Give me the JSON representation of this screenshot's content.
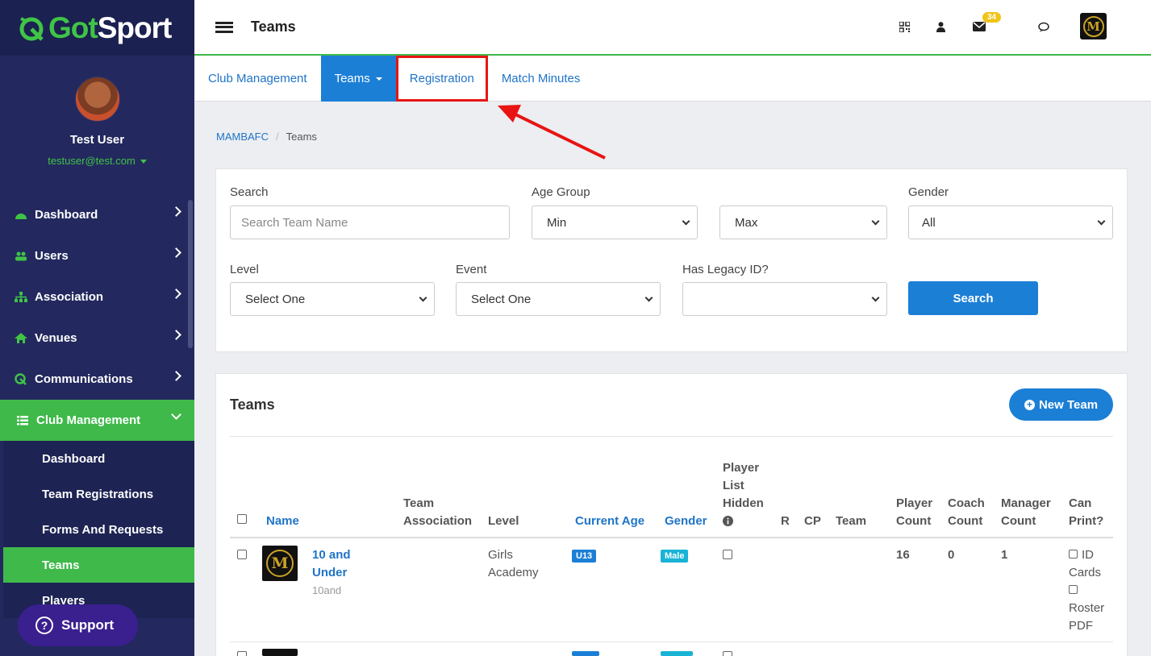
{
  "brand": {
    "logo_prefix": "Got",
    "logo_suffix": "Sport"
  },
  "user": {
    "name": "Test User",
    "email": "testuser@test.com"
  },
  "sidebar": {
    "items": [
      {
        "label": "Dashboard"
      },
      {
        "label": "Users"
      },
      {
        "label": "Association"
      },
      {
        "label": "Venues"
      },
      {
        "label": "Communications"
      },
      {
        "label": "Club Management"
      }
    ],
    "sub_items": [
      {
        "label": "Dashboard"
      },
      {
        "label": "Team Registrations"
      },
      {
        "label": "Forms And Requests"
      },
      {
        "label": "Teams"
      },
      {
        "label": "Players"
      }
    ],
    "support_label": "Support"
  },
  "topbar": {
    "title": "Teams",
    "mail_badge": "34",
    "club_logo_letter": "M"
  },
  "tabs": [
    {
      "label": "Club Management"
    },
    {
      "label": "Teams"
    },
    {
      "label": "Registration"
    },
    {
      "label": "Match Minutes"
    }
  ],
  "breadcrumb": {
    "root": "MAMBAFC",
    "current": "Teams"
  },
  "filters": {
    "search_label": "Search",
    "search_placeholder": "Search Team Name",
    "age_group_label": "Age Group",
    "age_min": "Min",
    "age_max": "Max",
    "gender_label": "Gender",
    "gender_value": "All",
    "level_label": "Level",
    "level_value": "Select One",
    "event_label": "Event",
    "event_value": "Select One",
    "legacy_label": "Has Legacy ID?",
    "legacy_value": "",
    "search_button": "Search"
  },
  "teams": {
    "title": "Teams",
    "new_team_button": "New Team",
    "columns": {
      "name": "Name",
      "team_association_1": "Team",
      "team_association_2": "Association",
      "level": "Level",
      "current_age": "Current Age",
      "gender": "Gender",
      "hidden_1": "Player",
      "hidden_2": "List",
      "hidden_3": "Hidden",
      "r": "R",
      "cp": "CP",
      "team": "Team",
      "player_count_1": "Player",
      "player_count_2": "Count",
      "coach_count_1": "Coach",
      "coach_count_2": "Count",
      "manager_count_1": "Manager",
      "manager_count_2": "Count",
      "can_print_1": "Can",
      "can_print_2": "Print?"
    },
    "rows": [
      {
        "name_1": "10 and",
        "name_2": "Under",
        "short": "10and",
        "level_1": "Girls",
        "level_2": "Academy",
        "age": "U13",
        "gender": "Male",
        "player_count": "16",
        "coach_count": "0",
        "manager_count": "1",
        "print_1a": "ID",
        "print_1b": "Cards",
        "print_2a": "Roster",
        "print_2b": "PDF"
      }
    ]
  },
  "colors": {
    "accent_green": "#3fb94a",
    "primary_blue": "#1c7fd6",
    "sidebar_navy": "#23295e",
    "highlight_red": "#e81414",
    "badge_yellow": "#f0c419"
  }
}
